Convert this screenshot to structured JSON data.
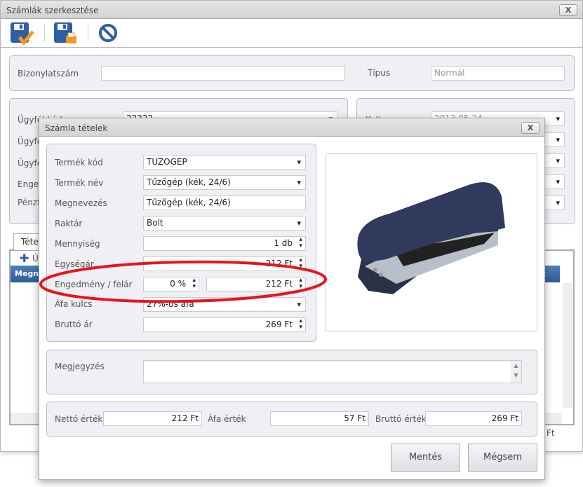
{
  "window": {
    "title": "Számlák szerkesztése",
    "close": "X"
  },
  "toolbar": {
    "icons": [
      "save-check-icon",
      "save-print-icon",
      "cancel-icon"
    ]
  },
  "header": {
    "doc_label": "Bizonylatszám",
    "doc_value": "",
    "type_label": "Típus",
    "type_value": "Normál"
  },
  "customer": {
    "labels": [
      "Ügyfél kód",
      "Ügyfé",
      "Ügyfé",
      "Enged",
      "Pénzf"
    ],
    "code_value": "22222",
    "date_label": "Kelt",
    "date_value": "2013.05.24"
  },
  "tabs": {
    "items_tab": "Tétel",
    "new_item": "Új",
    "grid_header": "Megnev",
    "grid_header_right": "k",
    "footer_right": "Ft"
  },
  "dialog": {
    "title": "Számla tételek",
    "close": "X",
    "fields": {
      "product_code": {
        "label": "Termék kód",
        "value": "TUZOGEP"
      },
      "product_name": {
        "label": "Termék név",
        "value": "Tűzőgép (kék, 24/6)"
      },
      "description": {
        "label": "Megnevezés",
        "value": "Tűzőgép (kék, 24/6)"
      },
      "warehouse": {
        "label": "Raktár",
        "value": "Bolt"
      },
      "quantity": {
        "label": "Mennyiség",
        "value": "1 db"
      },
      "unit_price": {
        "label": "Egységár",
        "value": "212 Ft"
      },
      "discount": {
        "label": "Engedmény / felár",
        "percent": "0 %",
        "amount": "212 Ft"
      },
      "vat": {
        "label": "Áfa kulcs",
        "value": "27%-os áfa"
      },
      "gross_price": {
        "label": "Bruttó ár",
        "value": "269 Ft"
      }
    },
    "note": {
      "label": "Megjegyzés",
      "value": ""
    },
    "totals": {
      "net_label": "Nettó érték",
      "net": "212 Ft",
      "vat_label": "Áfa érték",
      "vat": "57 Ft",
      "gross_label": "Bruttó érték",
      "gross": "269 Ft"
    },
    "buttons": {
      "save": "Mentés",
      "cancel": "Mégsem"
    },
    "highlight_color": "#e8141c"
  }
}
